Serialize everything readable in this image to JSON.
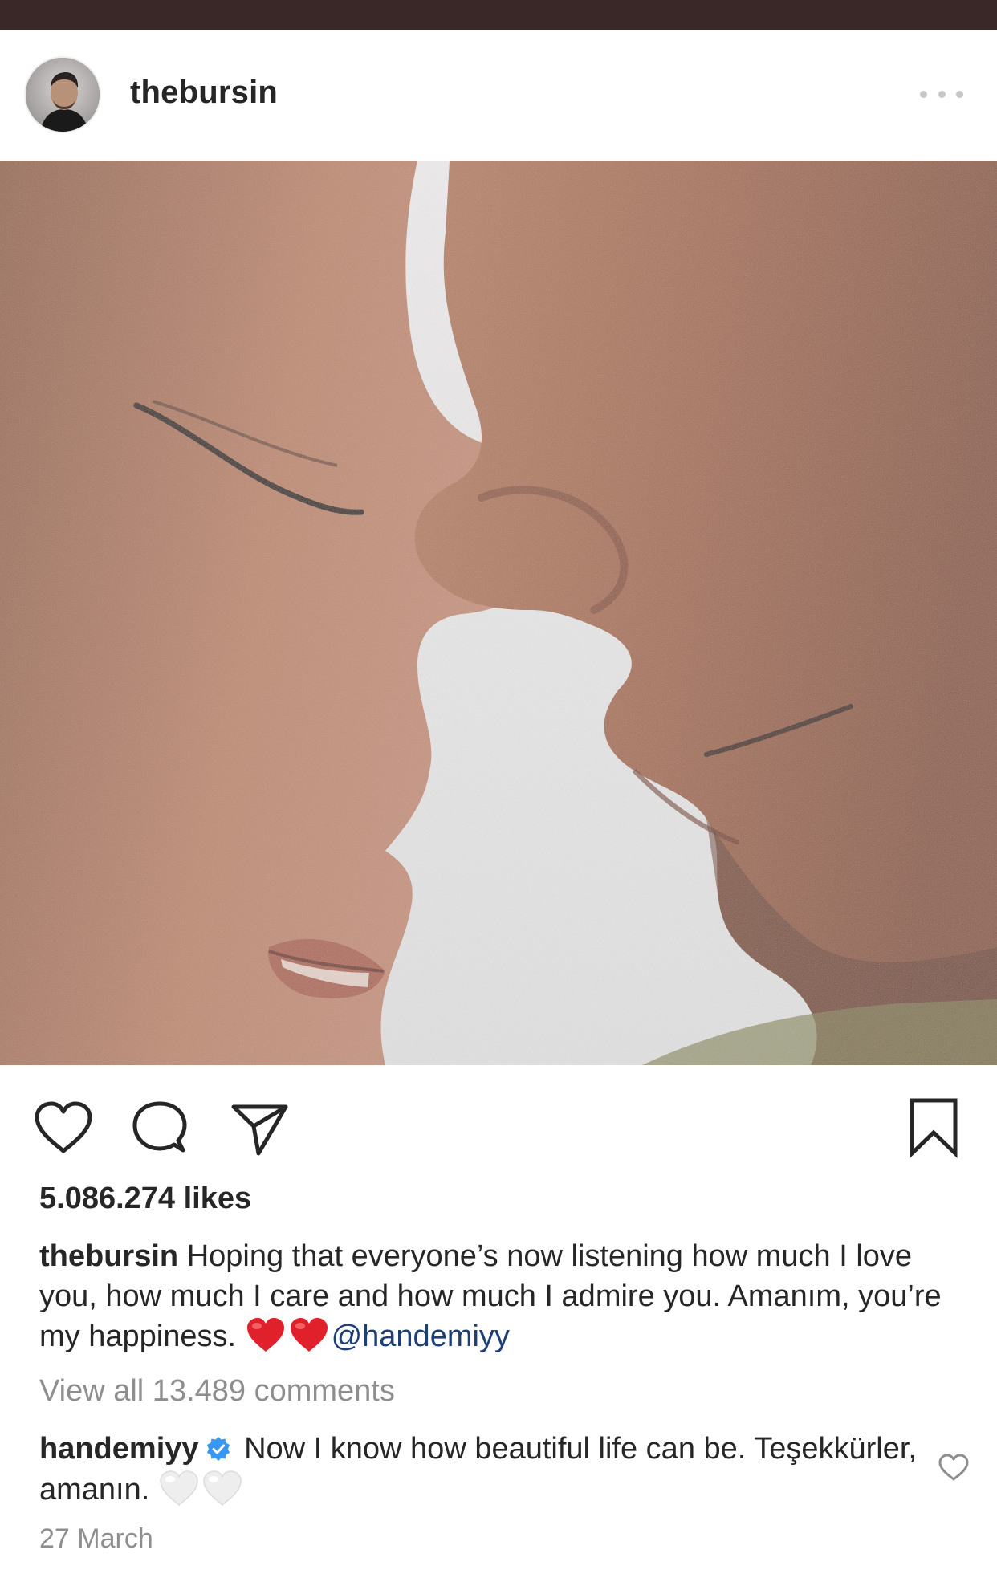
{
  "post": {
    "username": "thebursin",
    "likes": "5.086.274 likes",
    "caption": {
      "username": "thebursin",
      "text": "Hoping that everyone’s now listening how much I love you, how much I care and how much I admire you. Amanım, you’re my happiness.",
      "emoji": [
        "red-heart",
        "red-heart"
      ],
      "mention": "@handemiyy"
    },
    "view_all_comments": "View all 13.489 comments",
    "top_comment": {
      "username": "handemiyy",
      "verified": true,
      "text": "Now I know how beautiful life can be. Teşekkürler, amanın.",
      "emoji": [
        "white-heart",
        "white-heart"
      ]
    },
    "date": "27 March"
  },
  "icons": {
    "like": "heart-outline-icon",
    "comment": "speech-bubble-icon",
    "share": "paper-plane-icon",
    "save": "bookmark-icon",
    "more": "three-dots-icon",
    "verified": "verified-badge-icon"
  },
  "colors": {
    "top_bar": "#3a2828",
    "mention": "#1d3f75",
    "muted_text": "#8e8e8e",
    "verified_badge": "#3897f0",
    "heart_emoji": "#e0202a"
  }
}
